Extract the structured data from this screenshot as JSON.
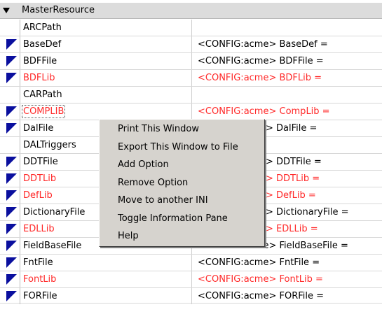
{
  "header": {
    "title": "MasterResource"
  },
  "rows": [
    {
      "name": "ARCPath",
      "value": ""
    },
    {
      "name": "BaseDef",
      "value": "<CONFIG:acme> BaseDef ="
    },
    {
      "name": "BDFFile",
      "value": "<CONFIG:acme> BDFFile ="
    },
    {
      "name": "BDFLib",
      "value": "<CONFIG:acme> BDFLib ="
    },
    {
      "name": "CARPath",
      "value": ""
    },
    {
      "name": "COMPLIB",
      "value": "<CONFIG:acme> CompLib ="
    },
    {
      "name": "DalFile",
      "value": "> DalFile ="
    },
    {
      "name": "DALTriggers",
      "value": ""
    },
    {
      "name": "DDTFile",
      "value": "> DDTFile ="
    },
    {
      "name": "DDTLib",
      "value": "> DDTLib ="
    },
    {
      "name": "DefLib",
      "value": "> DefLib ="
    },
    {
      "name": "DictionaryFile",
      "value": "> DictionaryFile ="
    },
    {
      "name": "EDLLib",
      "value": "> EDLLib ="
    },
    {
      "name": "FieldBaseFile",
      "value": "<CONFIG:acme> FieldBaseFile ="
    },
    {
      "name": "FntFile",
      "value": "<CONFIG:acme> FntFile ="
    },
    {
      "name": "FontLib",
      "value": "<CONFIG:acme> FontLib ="
    },
    {
      "name": "FORFile",
      "value": "<CONFIG:acme> FORFile ="
    }
  ],
  "context_menu": [
    "Print This Window",
    "Export This Window to File",
    "Add Option",
    "Remove Option",
    "Move to another INI",
    "Toggle Information Pane",
    "Help"
  ],
  "colors": {
    "highlight_text": "#ff2a2a",
    "marker": "#0a0f9e",
    "menu_bg": "#d6d3ce"
  }
}
